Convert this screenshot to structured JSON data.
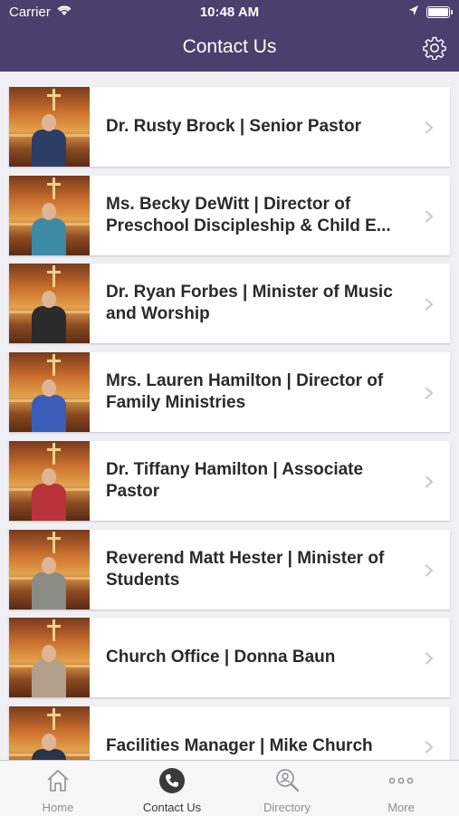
{
  "status_bar": {
    "carrier": "Carrier",
    "time": "10:48 AM"
  },
  "header": {
    "title": "Contact Us",
    "settings_icon": "gear-icon"
  },
  "contacts": [
    {
      "label": "Dr. Rusty Brock | Senior Pastor",
      "shirt": "#2c3d66"
    },
    {
      "label": "Ms. Becky DeWitt | Director of Preschool Discipleship & Child E...",
      "shirt": "#3d8aa4"
    },
    {
      "label": "Dr. Ryan Forbes | Minister of Music and Worship",
      "shirt": "#2b2b2b"
    },
    {
      "label": "Mrs. Lauren Hamilton | Director of Family Ministries",
      "shirt": "#3a5db8"
    },
    {
      "label": "Dr. Tiffany Hamilton | Associate Pastor",
      "shirt": "#b8333a"
    },
    {
      "label": "Reverend Matt Hester | Minister of Students",
      "shirt": "#8b8b86"
    },
    {
      "label": "Church Office | Donna Baun",
      "shirt": "#b49f8d"
    },
    {
      "label": "Facilities Manager | Mike Church",
      "shirt": "#26344a"
    }
  ],
  "tabs": [
    {
      "label": "Home",
      "icon": "home-icon",
      "active": false
    },
    {
      "label": "Contact Us",
      "icon": "phone-icon",
      "active": true
    },
    {
      "label": "Directory",
      "icon": "directory-search-icon",
      "active": false
    },
    {
      "label": "More",
      "icon": "more-dots-icon",
      "active": false
    }
  ],
  "colors": {
    "header": "#4b3f6e",
    "background": "#efeff4",
    "tab_bar": "#f7f7f7"
  }
}
